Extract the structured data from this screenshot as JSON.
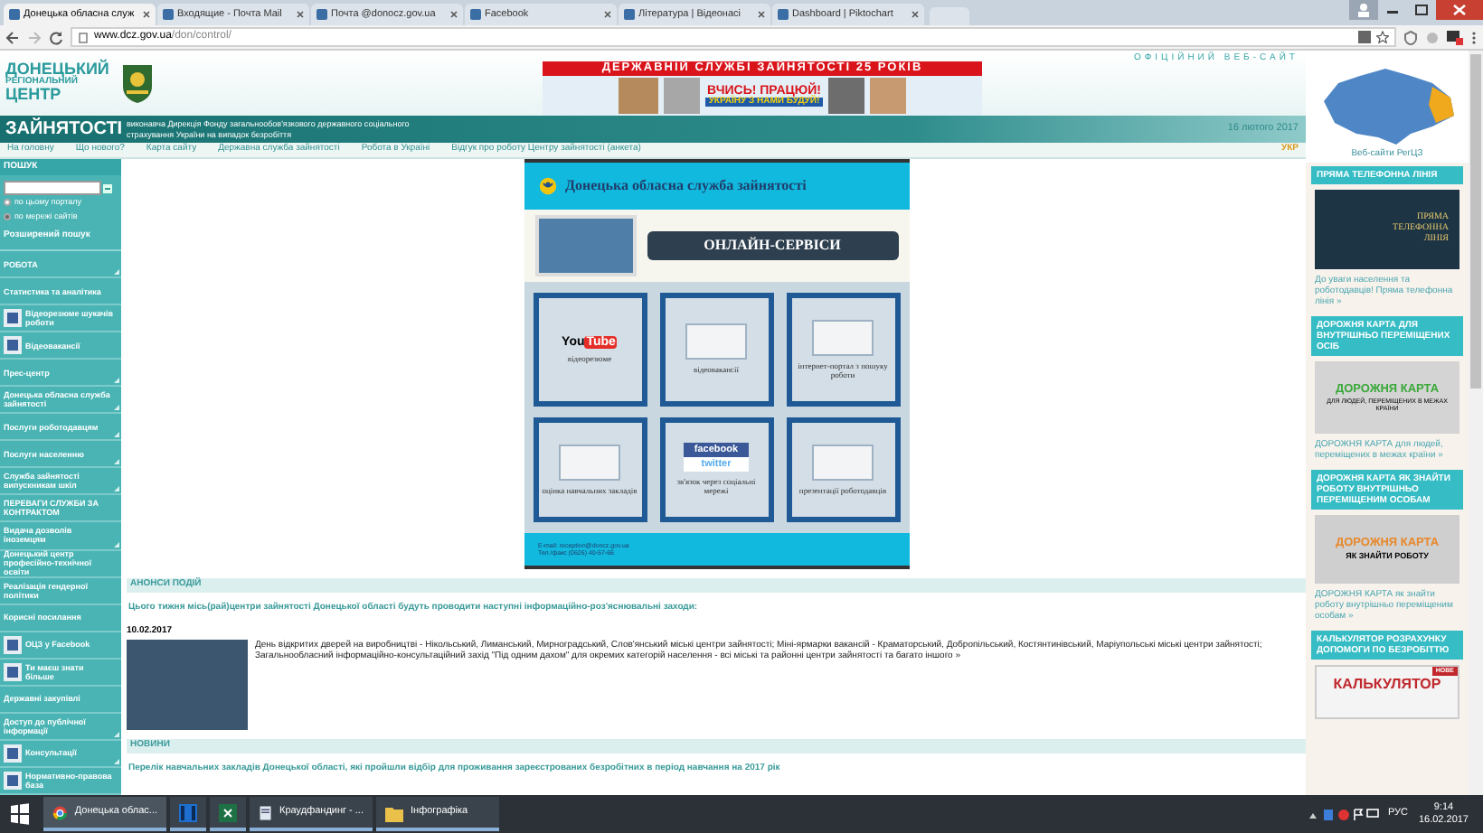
{
  "browser": {
    "tabs": [
      {
        "label": "Донецька обласна служ",
        "selected": true
      },
      {
        "label": "Входящие - Почта Mail",
        "selected": false
      },
      {
        "label": "Почта @donocz.gov.ua",
        "selected": false
      },
      {
        "label": "Facebook",
        "selected": false
      },
      {
        "label": "Література | Відеонасі",
        "selected": false
      },
      {
        "label": "Dashboard | Piktochart",
        "selected": false
      }
    ],
    "url_host": "www.dcz.gov.ua",
    "url_path": "/don/control/"
  },
  "header": {
    "logo_lines": [
      "ДОНЕЦЬКИЙ",
      "РЕГІОНАЛЬНИЙ",
      "ЦЕНТР",
      "ЗАЙНЯТОСТІ"
    ],
    "banner": {
      "band": "ДЕРЖАВНІЙ СЛУЖБІ ЗАЙНЯТОСТІ 25 РОКІВ",
      "slogan": "ВЧИСЬ! ПРАЦЮЙ!",
      "subslogan": "УКРАЇНУ З НАМИ БУДУЙ!"
    },
    "official": "ОФІЦІЙНИЙ ВЕБ-САЙТ",
    "subtitle": "виконавча Дирекція Фонду загальнообов'язкового державного соціального страхування України на випадок безробіття",
    "date": "16 лютого 2017"
  },
  "nav": {
    "links": [
      "На головну",
      "Що нового?",
      "Карта сайту",
      "Державна служба зайнятості",
      "Робота в Україні",
      "Відгук про роботу Центру зайнятості (анкета)"
    ],
    "language": "УКР"
  },
  "sidebar": {
    "search_title": "ПОШУК",
    "scope": [
      {
        "label": "по цьому порталу",
        "selected": false
      },
      {
        "label": "по мережі сайтів",
        "selected": true
      }
    ],
    "advanced": "Розширений пошук",
    "items": [
      {
        "label": "РОБОТА",
        "kind": "section",
        "expandable": true
      },
      {
        "label": "Статистика та аналітика",
        "kind": "plain",
        "expandable": false
      },
      {
        "label": "Відеорезюме шукачів роботи",
        "kind": "icon",
        "expandable": false
      },
      {
        "label": "Відеовакансії",
        "kind": "icon",
        "expandable": false
      },
      {
        "label": "Прес-центр",
        "kind": "plain",
        "expandable": true
      },
      {
        "label": "Донецька обласна служба зайнятості",
        "kind": "plain",
        "expandable": true
      },
      {
        "label": "Послуги роботодавцям",
        "kind": "plain",
        "expandable": true
      },
      {
        "label": "Послуги населенню",
        "kind": "plain",
        "expandable": true
      },
      {
        "label": "Служба зайнятості випускникам шкіл",
        "kind": "plain",
        "expandable": true
      },
      {
        "label": "ПЕРЕВАГИ СЛУЖБИ ЗА КОНТРАКТОМ",
        "kind": "plain",
        "expandable": false
      },
      {
        "label": "Видача дозволів іноземцям",
        "kind": "plain",
        "expandable": true
      },
      {
        "label": "Донецький центр професійно-технічної освіти",
        "kind": "plain",
        "expandable": false
      },
      {
        "label": "Реалізація гендерної політики",
        "kind": "plain",
        "expandable": false
      },
      {
        "label": "Корисні посилання",
        "kind": "plain",
        "expandable": false
      },
      {
        "label": "ОЦЗ у Facebook",
        "kind": "icon",
        "expandable": false
      },
      {
        "label": "Ти маєш знати більше",
        "kind": "icon",
        "expandable": false
      },
      {
        "label": "Державні закупівлі",
        "kind": "plain",
        "expandable": false
      },
      {
        "label": "Доступ до публічної інформації",
        "kind": "plain",
        "expandable": true
      },
      {
        "label": "Консультації",
        "kind": "icon",
        "expandable": true
      },
      {
        "label": "Нормативно-правова база",
        "kind": "icon",
        "expandable": false
      }
    ]
  },
  "infographic": {
    "title": "Донецька обласна служба зайнятості",
    "ribbon": "ОНЛАЙН-СЕРВІСИ",
    "tiles": [
      {
        "label": "відеорезюме",
        "kind": "youtube",
        "logo": [
          "You",
          "Tube"
        ]
      },
      {
        "label": "відеовакансії",
        "kind": "picture"
      },
      {
        "label": "інтернет-портал з пошуку роботи",
        "kind": "picture"
      },
      {
        "label": "оцінка навчальних закладів",
        "kind": "picture"
      },
      {
        "label": "зв'язок через соціальні мережі",
        "kind": "social",
        "logo": [
          "facebook",
          "twitter"
        ]
      },
      {
        "label": "презентації роботодавців",
        "kind": "picture"
      }
    ],
    "contacts": [
      "E-mail: reception@doncz.gov.ua",
      "Тел./факс (0626) 40-57-66"
    ]
  },
  "announcements": {
    "title": "АНОНСИ ПОДІЙ",
    "lead": "Цього тижня місь(рай)центри зайнятості Донецької області будуть проводити наступні інформаційно-роз'яснювальні заходи:",
    "date": "10.02.2017",
    "text": "День відкритих дверей на виробництві - Нікольський, Лиманський, Мирноградський, Слов'янський міські центри зайнятості; Міні-ярмарки вакансій - Краматорський, Добропільський, Костянтинівський, Маріупольські міські центри зайнятості; Загальнообласний інформаційно-консультаційний захід \"Під одним дахом\" для окремих категорій населення - всі міські та районні центри зайнятості та багато іншого »"
  },
  "news": {
    "title": "НОВИНИ",
    "items": [
      "Перелік навчальних закладів Донецької області, які пройшли відбір для проживання зареєстрованих безробітних в період навчання на 2017 рік"
    ]
  },
  "right": {
    "map_caption": "Веб-сайти РегЦЗ",
    "cards": [
      {
        "title": "ПРЯМА ТЕЛЕФОННА ЛІНІЯ",
        "kind": "phone",
        "image_text": [
          "ПРЯМА",
          "ТЕЛЕФОННА",
          "ЛІНІЯ"
        ],
        "caption": "До уваги населення та роботодавців! Пряма телефонна лінія »"
      },
      {
        "title": "ДОРОЖНЯ КАРТА ДЛЯ ВНУТРІШНЬО ПЕРЕМІЩЕНИХ ОСІБ",
        "kind": "roadmap",
        "image_text": [
          "ДОРОЖНЯ КАРТА",
          "ДЛЯ ЛЮДЕЙ, ПЕРЕМІЩЕНИХ В МЕЖАХ КРАЇНИ"
        ],
        "caption": "ДОРОЖНЯ КАРТА для людей, переміщених в межах країни »"
      },
      {
        "title": "ДОРОЖНЯ КАРТА ЯК ЗНАЙТИ РОБОТУ ВНУТРІШНЬО ПЕРЕМІЩЕНИМ ОСОБАМ",
        "kind": "roadmap2",
        "image_text": [
          "ДОРОЖНЯ КАРТА",
          "ЯК ЗНАЙТИ РОБОТУ"
        ],
        "caption": "ДОРОЖНЯ КАРТА як знайти роботу внутрішньо переміщеним особам »"
      },
      {
        "title": "КАЛЬКУЛЯТОР РОЗРАХУНКУ ДОПОМОГИ ПО БЕЗРОБІТТЮ",
        "kind": "calc",
        "image_text": [
          "НОВЕ",
          "КАЛЬКУЛЯТОР"
        ]
      }
    ]
  },
  "taskbar": {
    "apps": [
      {
        "label": "Донецька облас...",
        "kind": "chrome",
        "selected": true
      },
      {
        "kind": "video",
        "selected": false
      },
      {
        "kind": "excel",
        "selected": false
      },
      {
        "label": "Краудфандинг - ...",
        "kind": "doc",
        "selected": false
      },
      {
        "label": "Інфографіка",
        "kind": "folder",
        "selected": false
      }
    ],
    "language": "РУС",
    "time": "9:14",
    "date": "16.02.2017"
  }
}
